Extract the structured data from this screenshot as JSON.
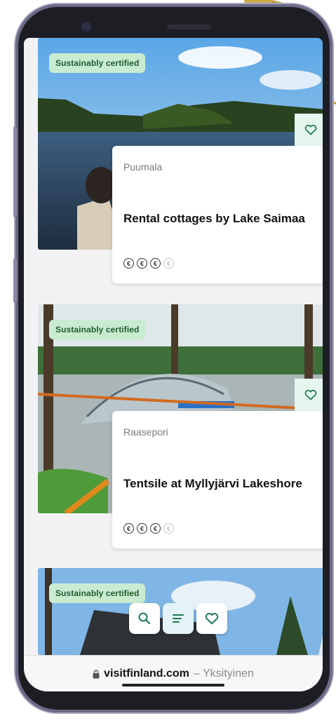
{
  "browser": {
    "url_domain": "visitfinland.com",
    "url_suffix": "– Yksityinen"
  },
  "listings": [
    {
      "badge": "Sustainably certified",
      "location": "Puumala",
      "title": "Rental cottages by Lake Saimaa",
      "price_symbols_total": 4,
      "price_symbols_active": 3,
      "price_symbol": "€"
    },
    {
      "badge": "Sustainably certified",
      "location": "Raasepori",
      "title": "Tentsile at Myllyjärvi Lakeshore",
      "price_symbols_total": 4,
      "price_symbols_active": 3,
      "price_symbol": "€"
    },
    {
      "badge": "Sustainably certified"
    }
  ],
  "floating_nav": {
    "icons": [
      "search-icon",
      "list-icon",
      "heart-icon"
    ],
    "active": "list-icon"
  },
  "colors": {
    "badge_bg": "#c9ecd1",
    "badge_text": "#1f5c2e",
    "accent_green": "#1f7a52",
    "frame": "#1d1d24"
  }
}
